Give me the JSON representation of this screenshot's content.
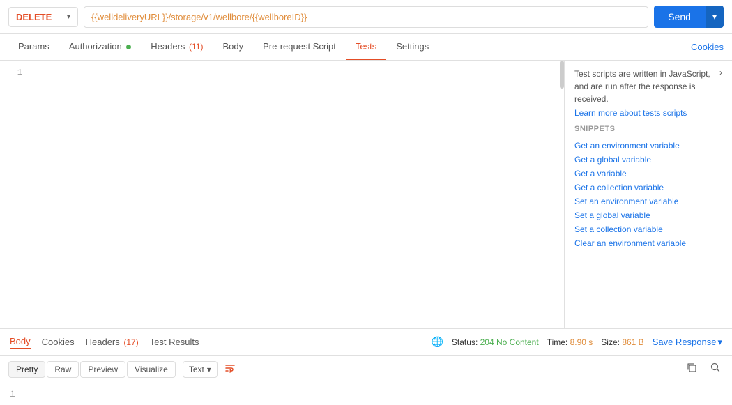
{
  "method": {
    "label": "DELETE",
    "chevron": "▾"
  },
  "url": "{{welldeliveryURL}}/storage/v1/wellbore/{{wellboreID}}",
  "send_button": {
    "label": "Send",
    "chevron": "▾"
  },
  "tabs": [
    {
      "id": "params",
      "label": "Params",
      "active": false,
      "badge": null,
      "auth_dot": false
    },
    {
      "id": "authorization",
      "label": "Authorization",
      "active": false,
      "badge": null,
      "auth_dot": true
    },
    {
      "id": "headers",
      "label": "Headers",
      "active": false,
      "badge": "(11)",
      "auth_dot": false
    },
    {
      "id": "body",
      "label": "Body",
      "active": false,
      "badge": null,
      "auth_dot": false
    },
    {
      "id": "prerequest",
      "label": "Pre-request Script",
      "active": false,
      "badge": null,
      "auth_dot": false
    },
    {
      "id": "tests",
      "label": "Tests",
      "active": true,
      "badge": null,
      "auth_dot": false
    },
    {
      "id": "settings",
      "label": "Settings",
      "active": false,
      "badge": null,
      "auth_dot": false
    }
  ],
  "cookies_label": "Cookies",
  "snippets_panel": {
    "intro_text": "Test scripts are written in JavaScript, and are run after the response is received.",
    "learn_more_text": "Learn more about tests scripts",
    "snippets_header": "SNIPPETS",
    "items": [
      "Get an environment variable",
      "Get a global variable",
      "Get a variable",
      "Get a collection variable",
      "Set an environment variable",
      "Set a global variable",
      "Set a collection variable",
      "Clear an environment variable"
    ]
  },
  "response_tabs": [
    {
      "id": "body",
      "label": "Body",
      "active": true,
      "badge": null
    },
    {
      "id": "cookies",
      "label": "Cookies",
      "active": false,
      "badge": null
    },
    {
      "id": "headers",
      "label": "Headers",
      "active": false,
      "badge": "(17)"
    },
    {
      "id": "test_results",
      "label": "Test Results",
      "active": false,
      "badge": null
    }
  ],
  "status": {
    "label": "Status:",
    "value": "204 No Content",
    "time_label": "Time:",
    "time_value": "8.90 s",
    "size_label": "Size:",
    "size_value": "861 B"
  },
  "save_response_label": "Save Response",
  "format_buttons": [
    {
      "id": "pretty",
      "label": "Pretty",
      "active": true
    },
    {
      "id": "raw",
      "label": "Raw",
      "active": false
    },
    {
      "id": "preview",
      "label": "Preview",
      "active": false
    },
    {
      "id": "visualize",
      "label": "Visualize",
      "active": false
    }
  ],
  "text_dropdown": {
    "label": "Text",
    "chevron": "▾"
  },
  "response_body_line": "1",
  "editor_line": "1"
}
